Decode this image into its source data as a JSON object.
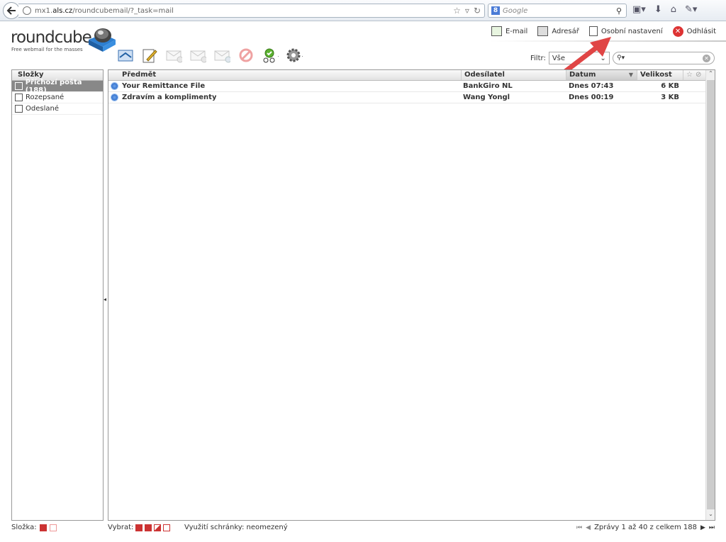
{
  "browser": {
    "url_host": "mx1.",
    "url_domain": "als.cz",
    "url_path": "/roundcubemail/?_task=mail",
    "search_placeholder": "Google",
    "search_engine_letter": "8"
  },
  "logo": {
    "title": "roundcube",
    "subtitle": "Free webmail for the masses"
  },
  "topnav": {
    "email": "E-mail",
    "addressbook": "Adresář",
    "settings": "Osobní nastavení",
    "logout": "Odhlásit"
  },
  "filter": {
    "label": "Filtr:",
    "value": "Vše"
  },
  "folders": {
    "header": "Složky",
    "items": [
      {
        "label": "Příchozí pošta (188)",
        "selected": true,
        "icon": "inbox-icon"
      },
      {
        "label": "Rozepsané",
        "selected": false,
        "icon": "drafts-icon"
      },
      {
        "label": "Odeslané",
        "selected": false,
        "icon": "sent-icon"
      }
    ]
  },
  "list": {
    "col_subject": "Předmět",
    "col_from": "Odesílatel",
    "col_date": "Datum",
    "col_size": "Velikost",
    "rows": [
      {
        "subject": "Your Remittance File",
        "from": "BankGiro NL",
        "date": "Dnes 07:43",
        "size": "6 KB"
      },
      {
        "subject": "Zdravím a komplimenty",
        "from": "Wang Yongl",
        "date": "Dnes 00:19",
        "size": "3 KB"
      }
    ]
  },
  "footer": {
    "folder_label": "Složka:",
    "select_label": "Vybrat:",
    "quota": "Využití schránky: neomezený",
    "count": "Zprávy 1 až 40 z celkem 188"
  },
  "colors": {
    "accent_red": "#cc3333",
    "unread_blue": "#1a5ec4",
    "selected_folder": "#888888"
  }
}
